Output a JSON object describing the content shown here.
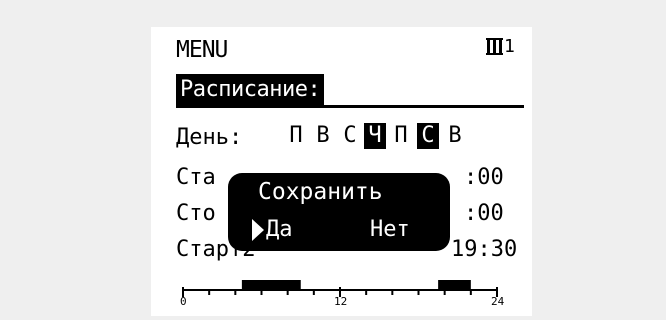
{
  "header": {
    "menu_title": "MENU",
    "circuit_number": "1",
    "circuit_icon": "radiator-icon"
  },
  "schedule": {
    "title": "Расписание:",
    "day_label": "День:",
    "days": [
      {
        "label": "П",
        "selected": false
      },
      {
        "label": "В",
        "selected": false
      },
      {
        "label": "С",
        "selected": false
      },
      {
        "label": "Ч",
        "selected": true
      },
      {
        "label": "П",
        "selected": false
      },
      {
        "label": "С",
        "selected": true
      },
      {
        "label": "В",
        "selected": false
      }
    ],
    "rows": [
      {
        "label": "Ста",
        "time": ":00"
      },
      {
        "label": "Сто",
        "time": ":00"
      },
      {
        "label": "Старт2",
        "time": "19:30"
      }
    ]
  },
  "dialog": {
    "title": "Сохранить",
    "yes_label": "Да",
    "no_label": "Нет"
  },
  "timeline": {
    "tick_labels": [
      "0",
      "12",
      "24"
    ],
    "active_periods": [
      {
        "start": 4.5,
        "end": 9.0
      },
      {
        "start": 19.5,
        "end": 22.0
      }
    ]
  },
  "colors": {
    "background": "#efefef",
    "lcd": "#ffffff",
    "ink": "#000000"
  }
}
